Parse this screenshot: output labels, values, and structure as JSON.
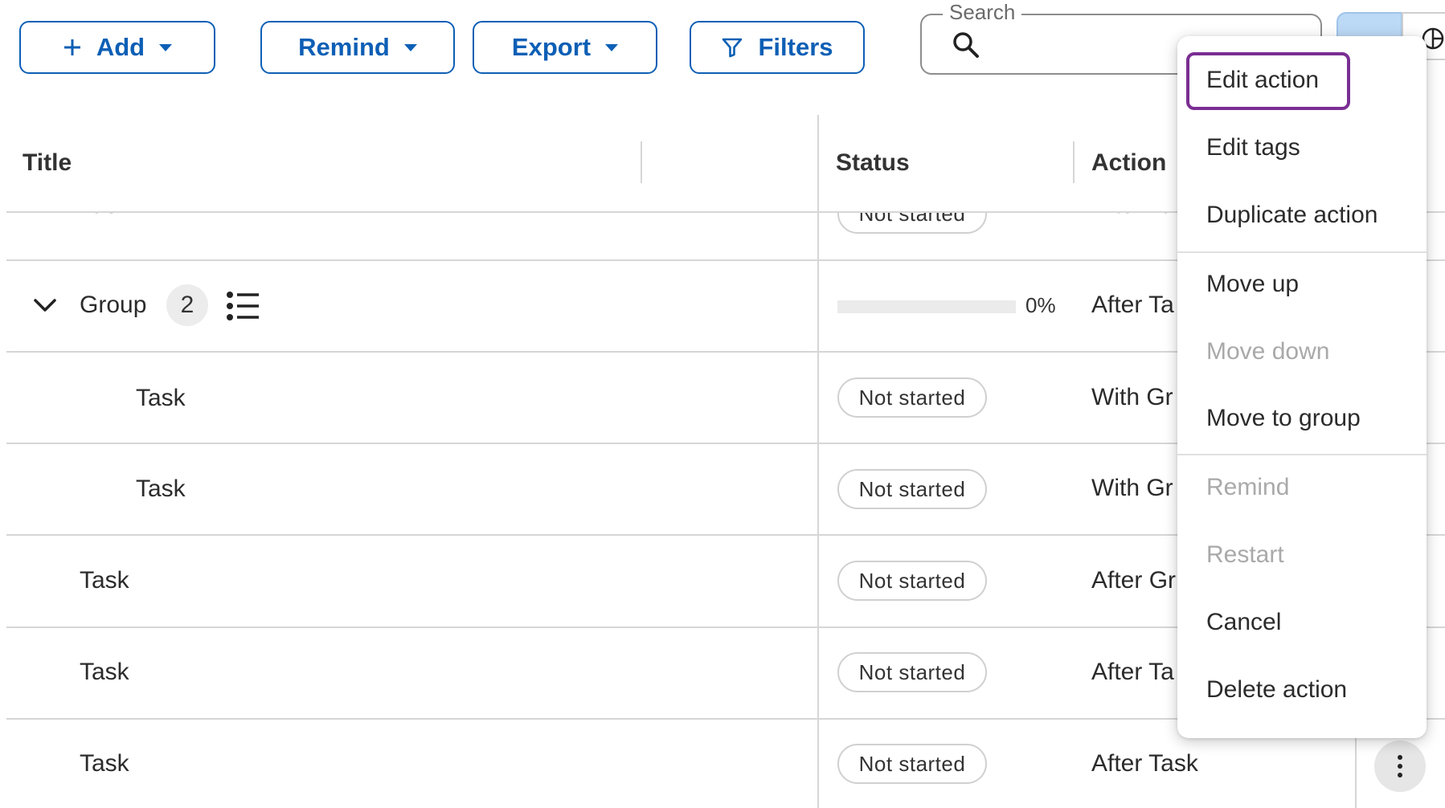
{
  "toolbar": {
    "add_label": "Add",
    "remind_label": "Remind",
    "export_label": "Export",
    "filters_label": "Filters"
  },
  "search": {
    "label": "Search",
    "placeholder": ""
  },
  "table": {
    "headers": {
      "title": "Title",
      "status": "Status",
      "action": "Action"
    },
    "rows": [
      {
        "title": "Task",
        "status": "Not started",
        "action": "After Ta"
      },
      {
        "title": "Group",
        "count": "2",
        "progress_text": "0%",
        "progress_value": 0,
        "action": "After Ta"
      },
      {
        "title": "Task",
        "status": "Not started",
        "action": "With Gr"
      },
      {
        "title": "Task",
        "status": "Not started",
        "action": "With Gr"
      },
      {
        "title": "Task",
        "status": "Not started",
        "action": "After Gr"
      },
      {
        "title": "Task",
        "status": "Not started",
        "action": "After Ta"
      },
      {
        "title": "Task",
        "status": "Not started",
        "action": "After Task"
      }
    ]
  },
  "context_menu": {
    "items": [
      {
        "label": "Edit action",
        "disabled": false,
        "focused": true
      },
      {
        "label": "Edit tags",
        "disabled": false
      },
      {
        "label": "Duplicate action",
        "disabled": false
      },
      {
        "label": "Move up",
        "disabled": false
      },
      {
        "label": "Move down",
        "disabled": true
      },
      {
        "label": "Move to group",
        "disabled": false
      },
      {
        "label": "Remind",
        "disabled": true
      },
      {
        "label": "Restart",
        "disabled": true
      },
      {
        "label": "Cancel",
        "disabled": false
      },
      {
        "label": "Delete action",
        "disabled": false
      }
    ]
  },
  "colors": {
    "accent": "#0d5fb5",
    "focus_ring": "#7a2e93",
    "disabled_text": "#a9a9a9"
  },
  "icons": [
    "plus-icon",
    "caret-down-icon",
    "filter-icon",
    "search-icon",
    "chevron-down-icon",
    "list-icon",
    "more-vertical-icon"
  ]
}
